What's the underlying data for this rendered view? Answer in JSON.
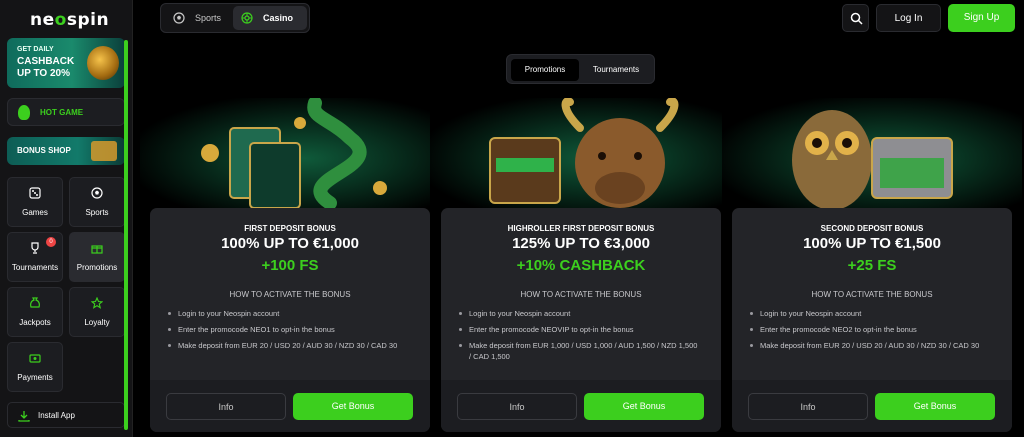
{
  "brand": {
    "logo_text_a": "ne",
    "logo_text_o": "o",
    "logo_text_b": "spin"
  },
  "sidebar": {
    "cashback": {
      "line1": "GET DAILY",
      "line2": "CASHBACK UP TO 20%"
    },
    "hot_game": {
      "label": "HOT GAME",
      "icon": "fire-icon"
    },
    "bonus_shop": {
      "label": "BONUS SHOP"
    },
    "tiles": [
      {
        "label": "Games",
        "icon": "dice-icon"
      },
      {
        "label": "Sports",
        "icon": "soccer-ball-icon"
      },
      {
        "label": "Tournaments",
        "icon": "trophy-icon",
        "badge": "0"
      },
      {
        "label": "Promotions",
        "icon": "gift-icon",
        "active": true
      },
      {
        "label": "Jackpots",
        "icon": "money-bag-icon"
      },
      {
        "label": "Loyalty",
        "icon": "star-icon"
      },
      {
        "label": "Payments",
        "icon": "cash-icon"
      }
    ],
    "install_app": {
      "label": "Install App",
      "icon": "download-icon"
    }
  },
  "header": {
    "tabs": [
      {
        "label": "Sports",
        "icon": "soccer-ball-icon"
      },
      {
        "label": "Casino",
        "icon": "roulette-icon",
        "active": true
      }
    ],
    "login": "Log In",
    "signup": "Sign Up"
  },
  "content_tabs": [
    "Promotions",
    "Tournaments"
  ],
  "bonuses": [
    {
      "subtitle": "FIRST DEPOSIT BONUS",
      "main": "100% UP TO €1,000",
      "extra": "+100 FS",
      "how_title": "HOW TO ACTIVATE THE BONUS",
      "steps": [
        "Login to your Neospin account",
        "Enter the promocode NEO1 to opt-in the bonus",
        "Make deposit from EUR 20 / USD 20 / AUD 30 / NZD 30 / CAD 30"
      ],
      "info": "Info",
      "get": "Get Bonus",
      "art": "snake-art"
    },
    {
      "subtitle": "HIGHROLLER FIRST DEPOSIT BONUS",
      "main": "125% UP TO €3,000",
      "extra": "+10% CASHBACK",
      "how_title": "HOW TO ACTIVATE THE BONUS",
      "steps": [
        "Login to your Neospin account",
        "Enter the promocode NEOVIP to opt-in the bonus",
        "Make deposit from EUR 1,000 / USD 1,000 / AUD 1,500 / NZD 1,500 / CAD 1,500"
      ],
      "info": "Info",
      "get": "Get Bonus",
      "art": "bull-art"
    },
    {
      "subtitle": "SECOND DEPOSIT BONUS",
      "main": "100% UP TO €1,500",
      "extra": "+25 FS",
      "how_title": "HOW TO ACTIVATE THE BONUS",
      "steps": [
        "Login to your Neospin account",
        "Enter the promocode NEO2 to opt-in the bonus",
        "Make deposit from EUR 20 / USD 20 / AUD 30 / NZD 30 / CAD 30"
      ],
      "info": "Info",
      "get": "Get Bonus",
      "art": "owl-art"
    }
  ],
  "colors": {
    "accent": "#3ccf1e",
    "panel": "#232428",
    "bg": "#000000"
  }
}
